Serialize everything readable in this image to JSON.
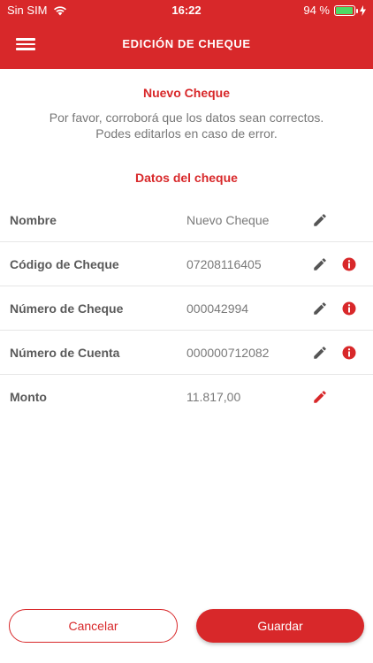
{
  "status_bar": {
    "carrier": "Sin SIM",
    "time": "16:22",
    "battery": "94 %",
    "battery_level": 0.94
  },
  "header": {
    "title": "EDICIÓN DE CHEQUE",
    "menu_icon": "hamburger-menu-icon"
  },
  "intro": {
    "title": "Nuevo Cheque",
    "line1": "Por favor, corroborá que los datos sean correctos.",
    "line2": "Podes editarlos en caso de error."
  },
  "section": {
    "title": "Datos del cheque"
  },
  "fields": [
    {
      "label": "Nombre",
      "value": "Nuevo Cheque",
      "edit_icon": "pencil-icon",
      "has_error": false
    },
    {
      "label": "Código de Cheque",
      "value": "07208116405",
      "edit_icon": "pencil-icon",
      "has_error": true
    },
    {
      "label": "Número de Cheque",
      "value": "000042994",
      "edit_icon": "pencil-icon",
      "has_error": true
    },
    {
      "label": "Número de Cuenta",
      "value": "000000712082",
      "edit_icon": "pencil-icon",
      "has_error": true
    },
    {
      "label": "Monto",
      "value": "11.817,00",
      "edit_icon": "pencil-icon",
      "has_error": false,
      "edit_highlight": true
    }
  ],
  "actions": {
    "cancel_label": "Cancelar",
    "save_label": "Guardar"
  },
  "colors": {
    "primary": "#d8282a",
    "icon_gray": "#555555",
    "battery": "#4cd964"
  }
}
